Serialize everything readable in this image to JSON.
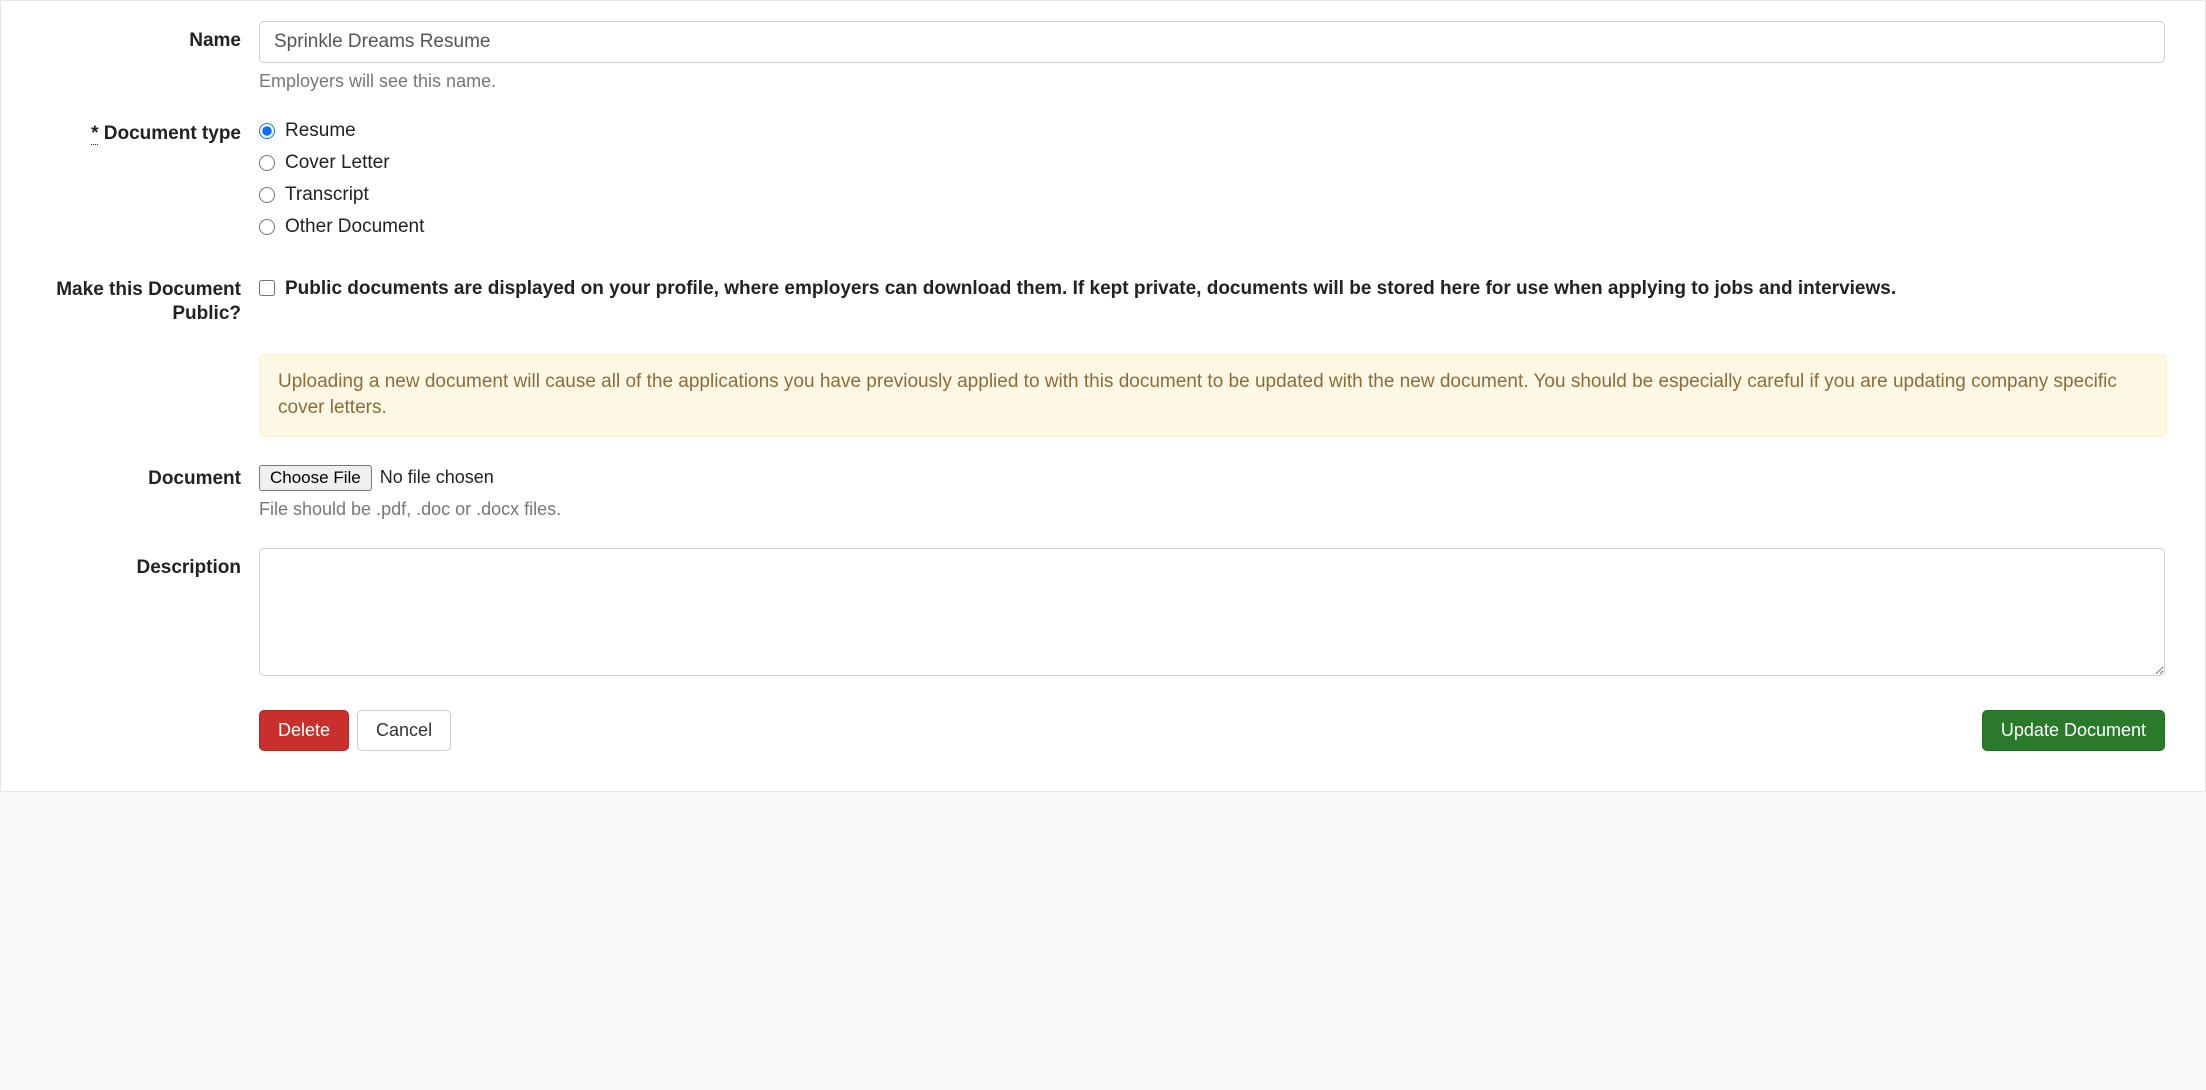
{
  "form": {
    "name": {
      "label": "Name",
      "value": "Sprinkle Dreams Resume",
      "help": "Employers will see this name."
    },
    "document_type": {
      "required_mark": "*",
      "label": "Document type",
      "options": [
        {
          "label": "Resume",
          "checked": true
        },
        {
          "label": "Cover Letter",
          "checked": false
        },
        {
          "label": "Transcript",
          "checked": false
        },
        {
          "label": "Other Document",
          "checked": false
        }
      ]
    },
    "public": {
      "label": "Make this Document Public?",
      "checked": false,
      "description": "Public documents are displayed on your profile, where employers can download them. If kept private, documents will be stored here for use when applying to jobs and interviews."
    },
    "warning": "Uploading a new document will cause all of the applications you have previously applied to with this document to be updated with the new document. You should be especially careful if you are updating company specific cover letters.",
    "document": {
      "label": "Document",
      "button": "Choose File",
      "status": "No file chosen",
      "help": "File should be .pdf, .doc or .docx files."
    },
    "description": {
      "label": "Description",
      "value": ""
    },
    "buttons": {
      "delete": "Delete",
      "cancel": "Cancel",
      "submit": "Update Document"
    }
  }
}
